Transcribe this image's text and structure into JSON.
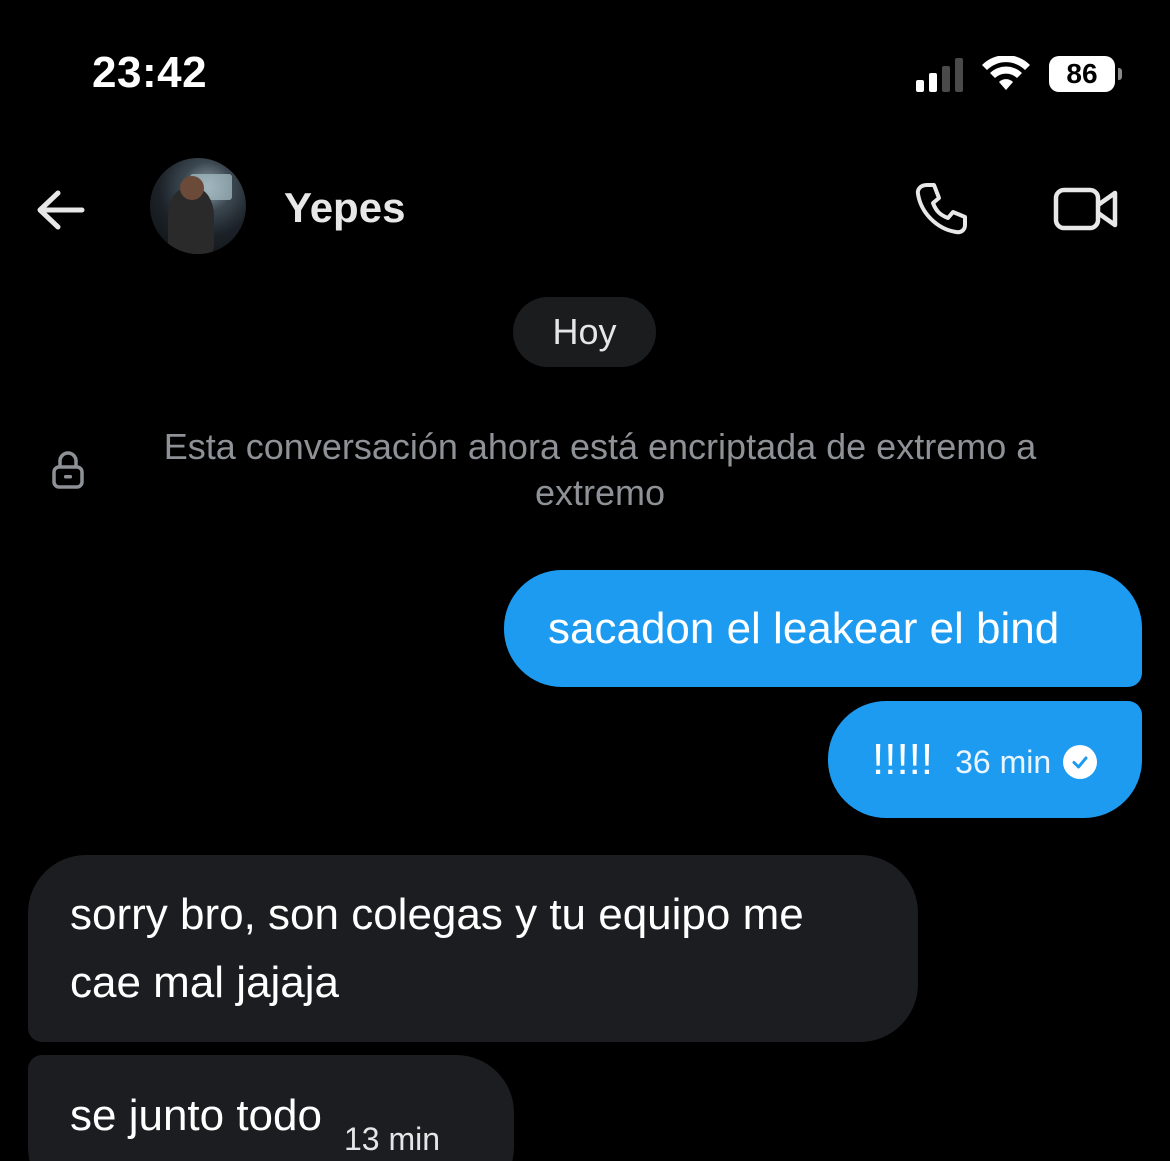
{
  "status_bar": {
    "time": "23:42",
    "battery": "86",
    "signal_bars_active": 2,
    "signal_bars_total": 4
  },
  "header": {
    "back_icon": "arrow-left-icon",
    "contact_name": "Yepes",
    "call_icon": "phone-icon",
    "video_icon": "video-camera-icon"
  },
  "conversation": {
    "day_label": "Hoy",
    "encryption_icon": "lock-icon",
    "encryption_notice": "Esta conversación ahora está encriptada de extremo a extremo",
    "messages": [
      {
        "direction": "outgoing",
        "text": "sacadon el leakear el bind",
        "time": ""
      },
      {
        "direction": "outgoing",
        "text": "!!!!!",
        "time": "36 min",
        "status_icon": "sent-check-icon"
      },
      {
        "direction": "incoming",
        "text": "sorry bro, son colegas y tu equipo me cae mal jajaja",
        "time": ""
      },
      {
        "direction": "incoming",
        "text": "se junto todo",
        "time": "13 min"
      }
    ]
  },
  "colors": {
    "background": "#000000",
    "outgoing_bubble": "#1d9bf0",
    "incoming_bubble": "#1c1d20",
    "muted_text": "#8e9196"
  }
}
